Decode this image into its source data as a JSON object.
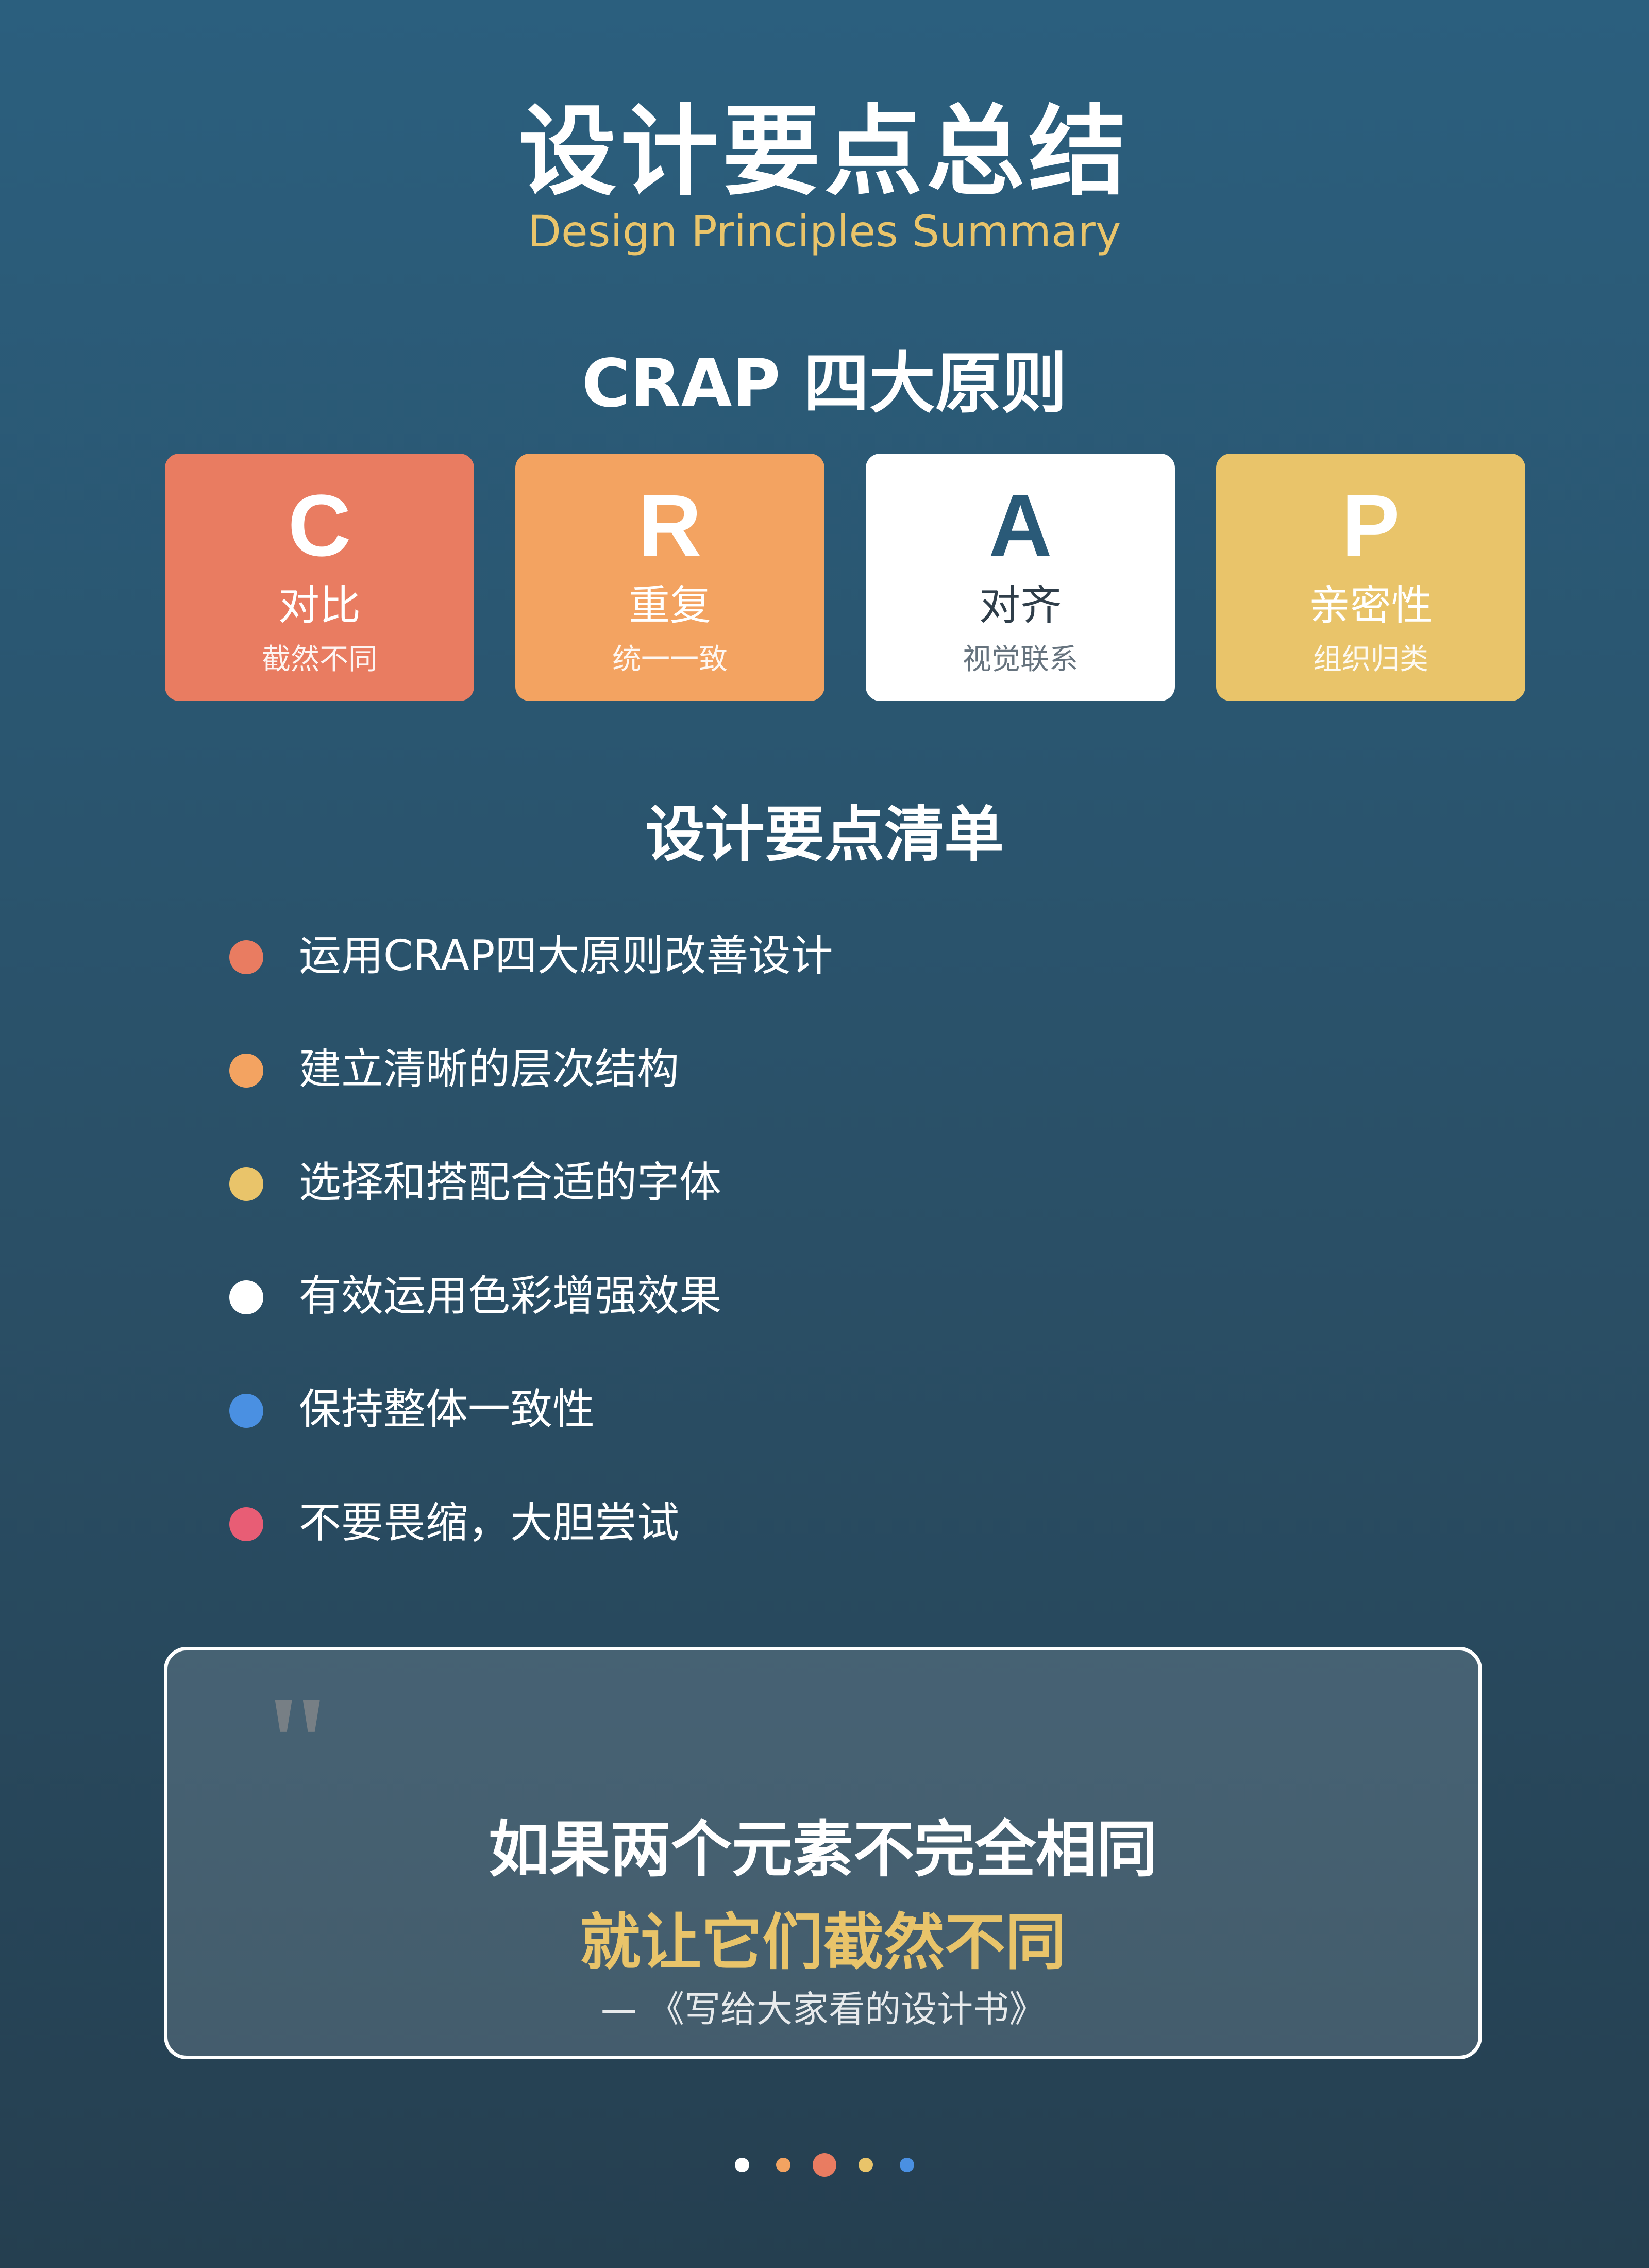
{
  "header": {
    "title": "设计要点总结",
    "subtitle": "Design Principles Summary"
  },
  "crap": {
    "heading": "CRAP 四大原则",
    "cards": [
      {
        "letter": "C",
        "name": "对比",
        "desc": "截然不同",
        "color": "#e97c61"
      },
      {
        "letter": "R",
        "name": "重复",
        "desc": "统一一致",
        "color": "#f3a361"
      },
      {
        "letter": "A",
        "name": "对齐",
        "desc": "视觉联系",
        "color": "#ffffff"
      },
      {
        "letter": "P",
        "name": "亲密性",
        "desc": "组织归类",
        "color": "#e9c46a"
      }
    ]
  },
  "checklist": {
    "heading": "设计要点清单",
    "items": [
      {
        "text": "运用CRAP四大原则改善设计",
        "color": "#e97c61"
      },
      {
        "text": "建立清晰的层次结构",
        "color": "#f3a361"
      },
      {
        "text": "选择和搭配合适的字体",
        "color": "#e9c46a"
      },
      {
        "text": "有效运用色彩增强效果",
        "color": "#ffffff"
      },
      {
        "text": "保持整体一致性",
        "color": "#4a90e2"
      },
      {
        "text": "不要畏缩，大胆尝试",
        "color": "#e85d75"
      }
    ]
  },
  "quote": {
    "mark": "\"",
    "line1": "如果两个元素不完全相同",
    "line2": "就让它们截然不同",
    "source": "— 《写给大家看的设计书》"
  },
  "pager": {
    "dots": [
      {
        "color": "#ffffff",
        "active": false
      },
      {
        "color": "#f3a361",
        "active": false
      },
      {
        "color": "#e97c61",
        "active": true
      },
      {
        "color": "#e9c46a",
        "active": false
      },
      {
        "color": "#4a90e2",
        "active": false
      }
    ]
  }
}
